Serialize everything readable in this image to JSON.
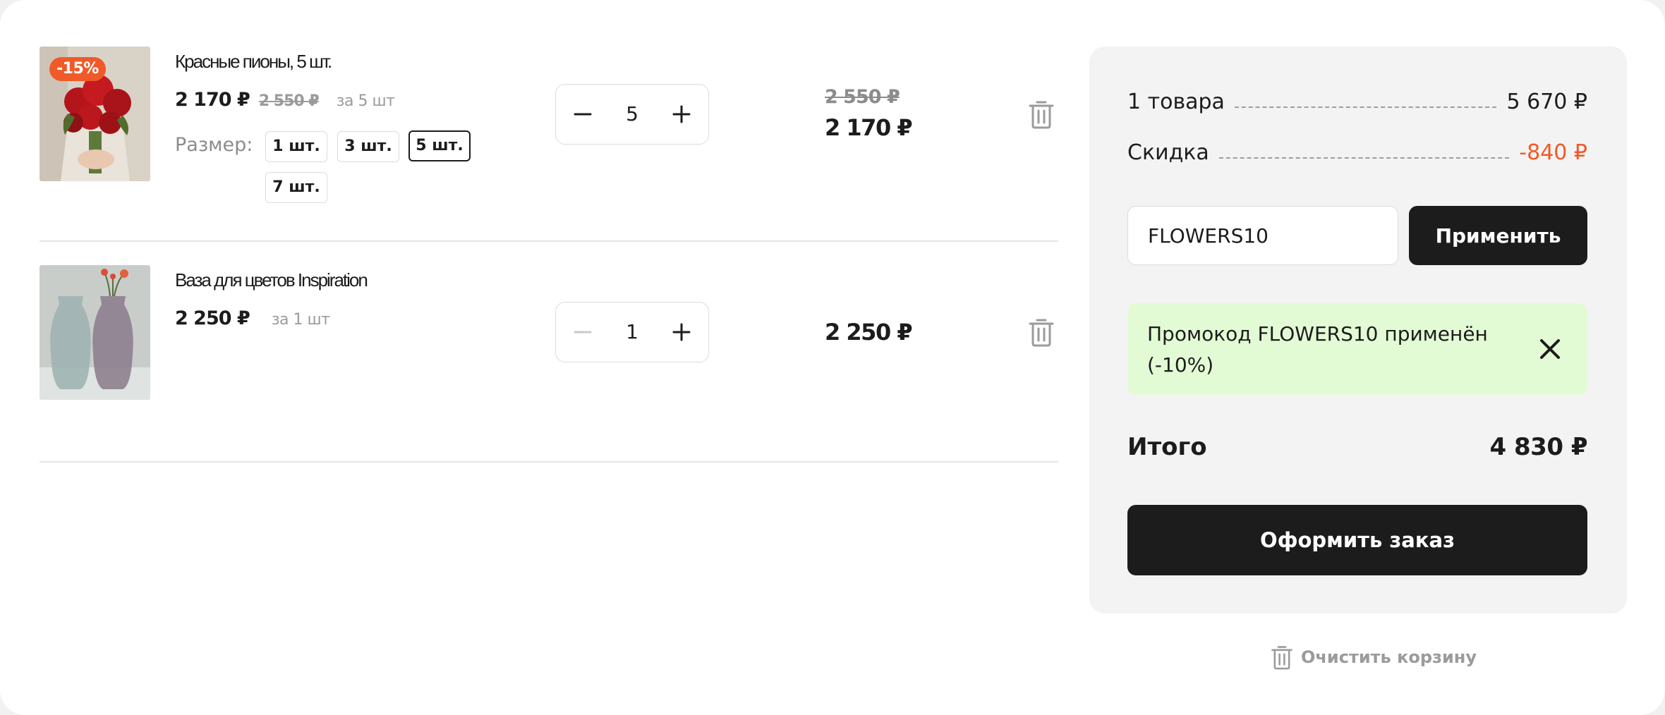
{
  "cart": {
    "items": [
      {
        "title": "Красные пионы, 5 шт.",
        "badge": "-15%",
        "price_current": "2 170 ₽",
        "price_old": "2 550 ₽",
        "per_unit": "за 5 шт",
        "size_label": "Размер:",
        "sizes": [
          "1 шт.",
          "3 шт.",
          "5 шт.",
          "7 шт."
        ],
        "selected_size": "5 шт.",
        "quantity": "5",
        "line_total_old": "2 550 ₽",
        "line_total": "2 170 ₽"
      },
      {
        "title": "Ваза для цветов Inspiration",
        "price_current": "2 250 ₽",
        "per_unit": "за 1 шт",
        "quantity": "1",
        "line_total": "2 250 ₽"
      }
    ]
  },
  "summary": {
    "items_label": "1 товара",
    "items_value": "5 670 ₽",
    "discount_label": "Скидка",
    "discount_value": "-840 ₽",
    "promo_value": "FLOWERS10",
    "apply_label": "Применить",
    "promo_notice": "Промокод FLOWERS10 применён (-10%)",
    "total_label": "Итого",
    "total_value": "4 830 ₽",
    "checkout_label": "Оформить заказ",
    "clear_label": "Очистить корзину"
  },
  "colors": {
    "accent": "#f05a28",
    "dark": "#1c1c1c",
    "muted": "#9b9b9b",
    "success_bg": "#e3fbd5",
    "panel_bg": "#f3f3f3"
  },
  "icons": [
    "minus-icon",
    "plus-icon",
    "trash-icon",
    "close-icon"
  ]
}
